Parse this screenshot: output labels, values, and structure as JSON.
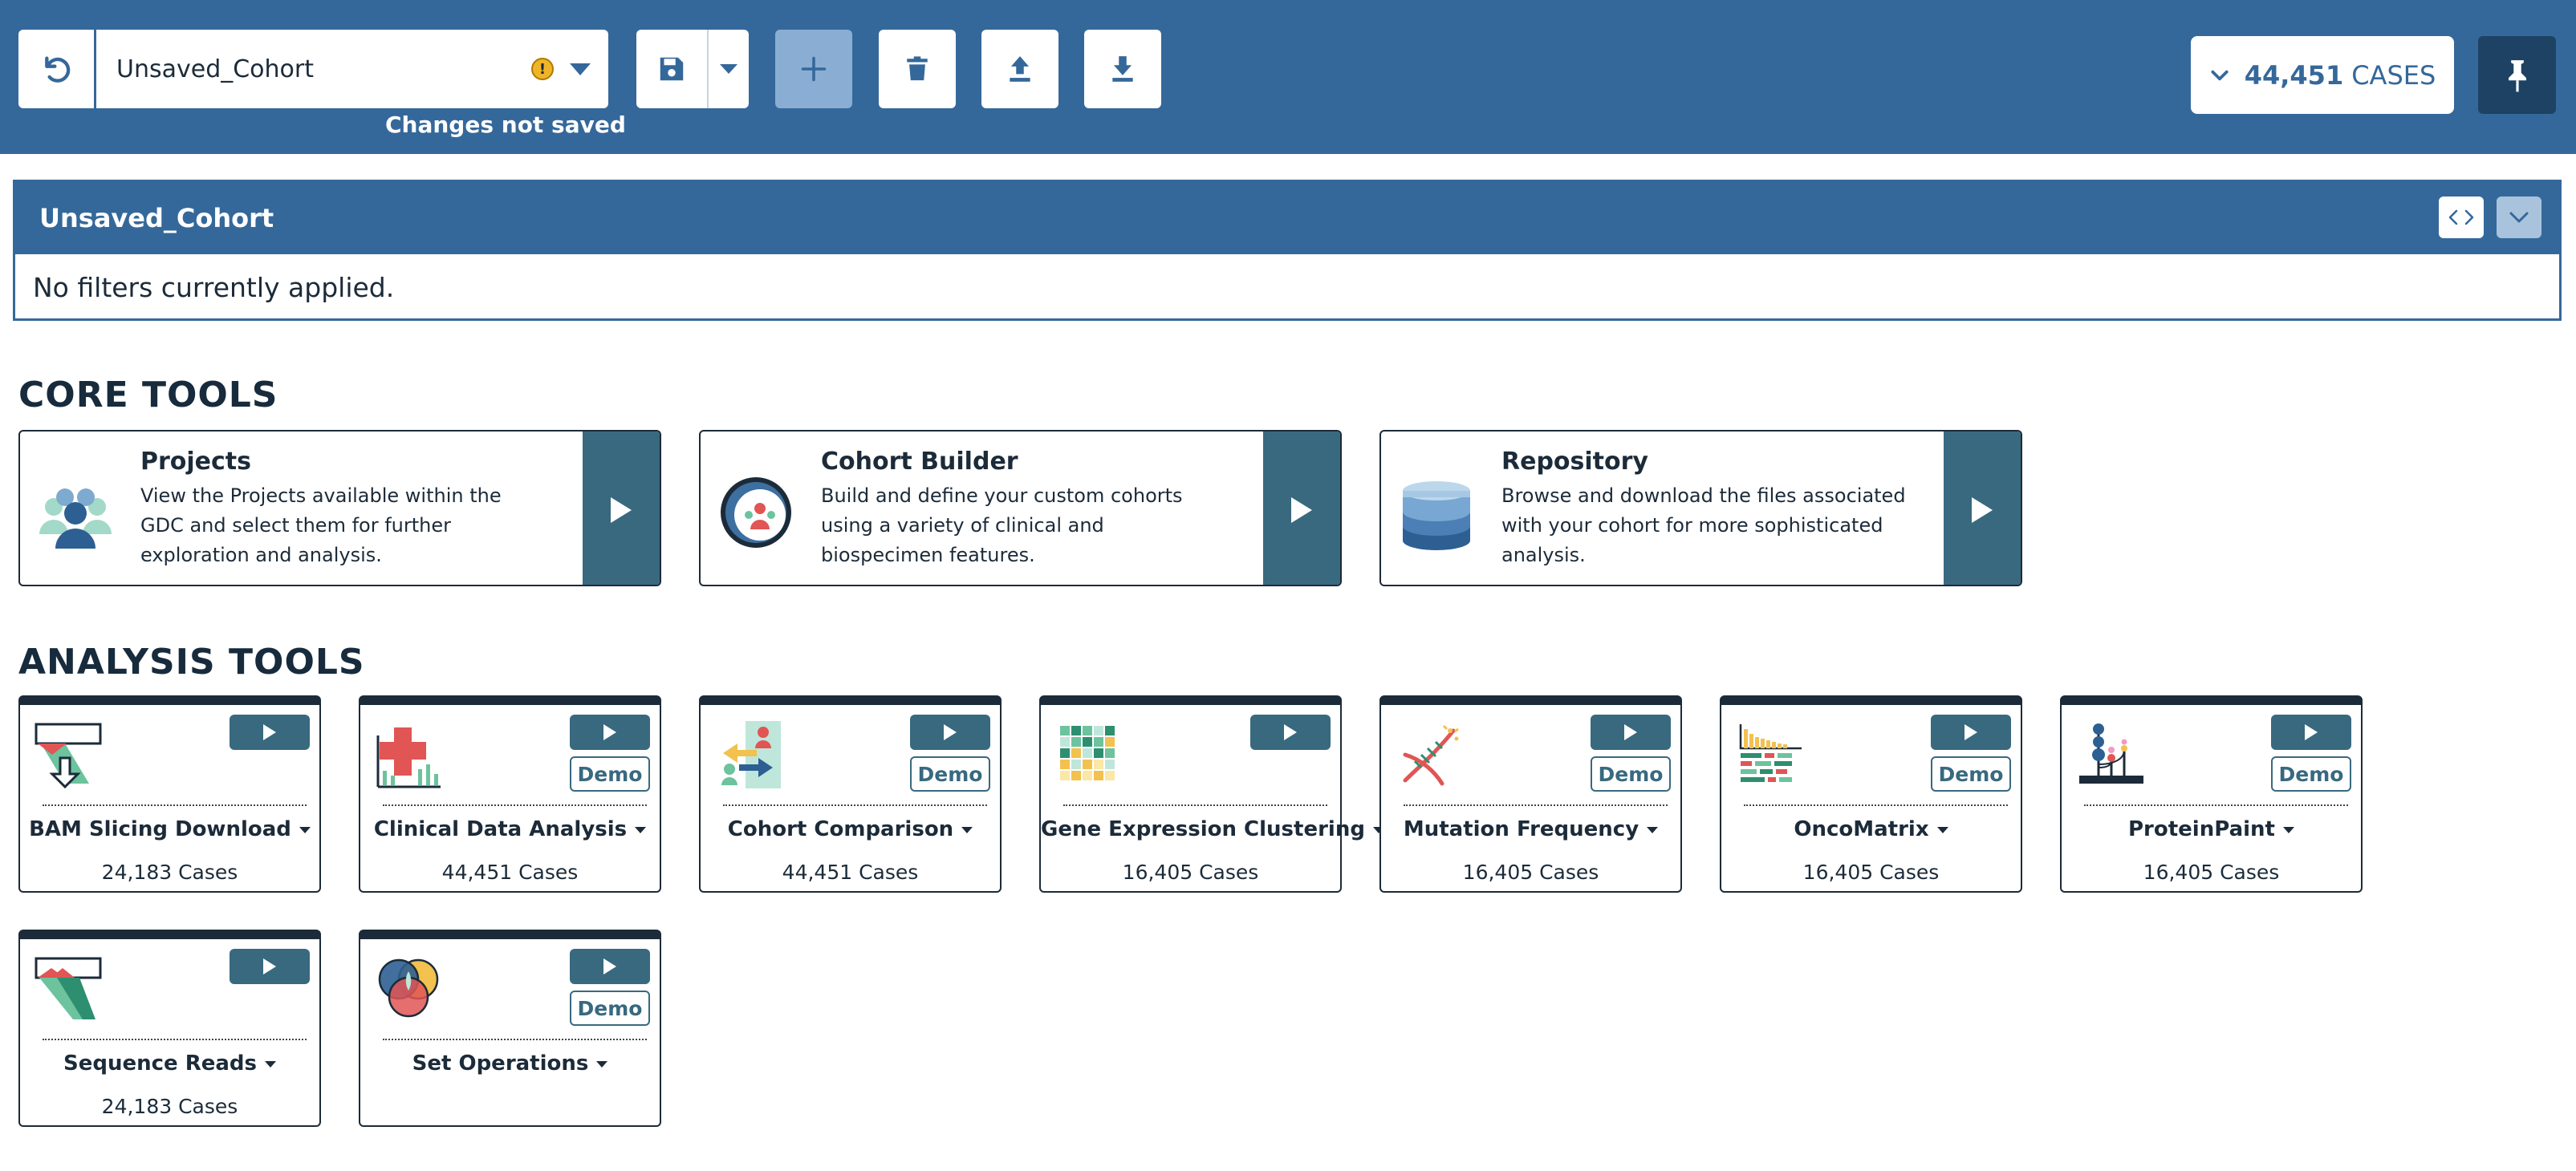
{
  "header": {
    "cohort_name": "Unsaved_Cohort",
    "warning_icon": "!",
    "unsaved_note": "Changes not saved",
    "cases_count": "44,451",
    "cases_label": "CASES"
  },
  "panel": {
    "title": "Unsaved_Cohort",
    "empty_text": "No filters currently applied."
  },
  "core_tools": {
    "heading": "CORE TOOLS",
    "cards": [
      {
        "title": "Projects",
        "description": "View the Projects available within the GDC and select them for further exploration and analysis."
      },
      {
        "title": "Cohort Builder",
        "description": "Build and define your custom cohorts using a variety of clinical and biospecimen features."
      },
      {
        "title": "Repository",
        "description": "Browse and download the files associated with your cohort for more sophisticated analysis."
      }
    ]
  },
  "analysis_tools": {
    "heading": "ANALYSIS TOOLS",
    "demo_label": "Demo",
    "tools": [
      {
        "name": "BAM Slicing Download",
        "cases": "24,183 Cases"
      },
      {
        "name": "Clinical Data Analysis",
        "cases": "44,451 Cases"
      },
      {
        "name": "Cohort Comparison",
        "cases": "44,451 Cases"
      },
      {
        "name": "Gene Expression Clustering",
        "cases": "16,405 Cases"
      },
      {
        "name": "Mutation Frequency",
        "cases": "16,405 Cases"
      },
      {
        "name": "OncoMatrix",
        "cases": "16,405 Cases"
      },
      {
        "name": "ProteinPaint",
        "cases": "16,405 Cases"
      },
      {
        "name": "Sequence Reads",
        "cases": "24,183 Cases"
      },
      {
        "name": "Set Operations",
        "cases": ""
      }
    ]
  },
  "colors": {
    "header_bg": "#35689a",
    "tool_accent": "#38697f",
    "dark_navy": "#1c2b39",
    "pin_bg": "#1d4263"
  }
}
